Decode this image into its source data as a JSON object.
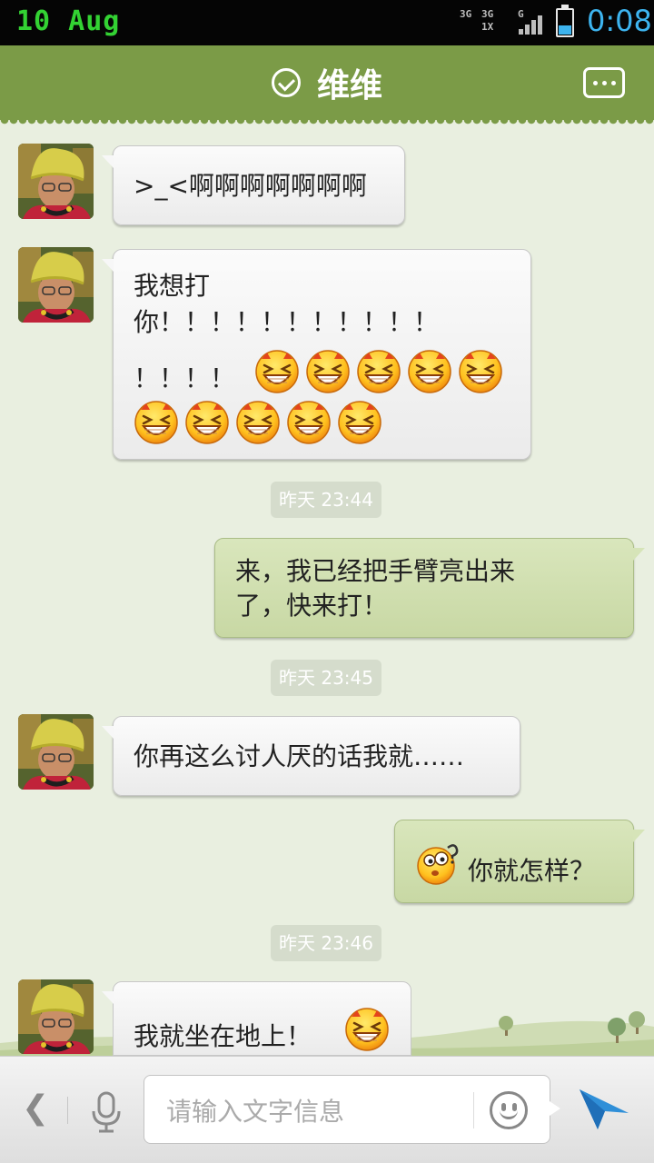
{
  "status_bar": {
    "date": "10 Aug",
    "network_1": "3G",
    "network_2": "3G 1X",
    "network_3": "G",
    "time": "0:08",
    "battery_level": 0.35,
    "time_color": "#3db4ef",
    "date_color": "#33d233"
  },
  "header": {
    "title": "维维",
    "accent": "#7b9b47"
  },
  "messages": [
    {
      "side": "in",
      "text": ">_<啊啊啊啊啊啊啊"
    },
    {
      "side": "in",
      "line1": "我想打",
      "line2": "你！！！！！！！！！！！",
      "line3": "！！！！",
      "emoji_count": 10,
      "emoji": "laughing-face-icon"
    },
    {
      "side": "timestamp",
      "text": "昨天 23:44"
    },
    {
      "side": "out",
      "line1": "来，我已经把手臂亮出来",
      "line2": "了，快来打！"
    },
    {
      "side": "timestamp",
      "text": "昨天 23:45"
    },
    {
      "side": "in",
      "text": "你再这么讨人厌的话我就……"
    },
    {
      "side": "out",
      "emoji": "confused-face-icon",
      "text": "你就怎样？"
    },
    {
      "side": "timestamp",
      "text": "昨天 23:46"
    },
    {
      "side": "in",
      "text": "我就坐在地上！",
      "emoji": "laughing-face-icon"
    }
  ],
  "input_bar": {
    "placeholder": "请输入文字信息",
    "back_icon": "chevron-left-icon",
    "mic_icon": "microphone-icon",
    "emoji_icon": "smiley-icon",
    "send_icon": "paper-plane-icon",
    "send_color": "#2f8fd8"
  }
}
